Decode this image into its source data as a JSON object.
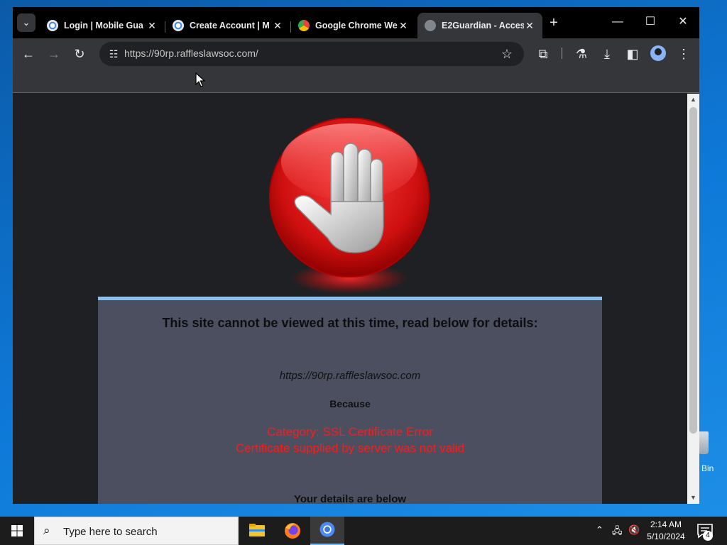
{
  "tabs": [
    {
      "title": "Login | Mobile Gua",
      "favicon": "chromium-icon",
      "active": false
    },
    {
      "title": "Create Account | M",
      "favicon": "chromium-icon",
      "active": false
    },
    {
      "title": "Google Chrome We",
      "favicon": "chrome-icon",
      "active": false
    },
    {
      "title": "E2Guardian - Acces",
      "favicon": "globe-icon",
      "active": true
    }
  ],
  "omnibox": {
    "url": "https://90rp.raffleslawsoc.com/"
  },
  "page": {
    "heading": "This site cannot be viewed at this time, read below for details:",
    "blocked_url": "https://90rp.raffleslawsoc.com",
    "because": "Because",
    "category": "Category: SSL Certificate Error",
    "reason": "Certificate supplied by server was not valid",
    "more": "Your details are below"
  },
  "desktop": {
    "recycle_bin_label": "Bin"
  },
  "taskbar": {
    "search_placeholder": "Type here to search",
    "time": "2:14 AM",
    "date": "5/10/2024",
    "notification_count": "4"
  },
  "colors": {
    "accent": "#76b9ed",
    "error_text": "#ff1a1a",
    "panel_bg": "#4b4f60"
  }
}
